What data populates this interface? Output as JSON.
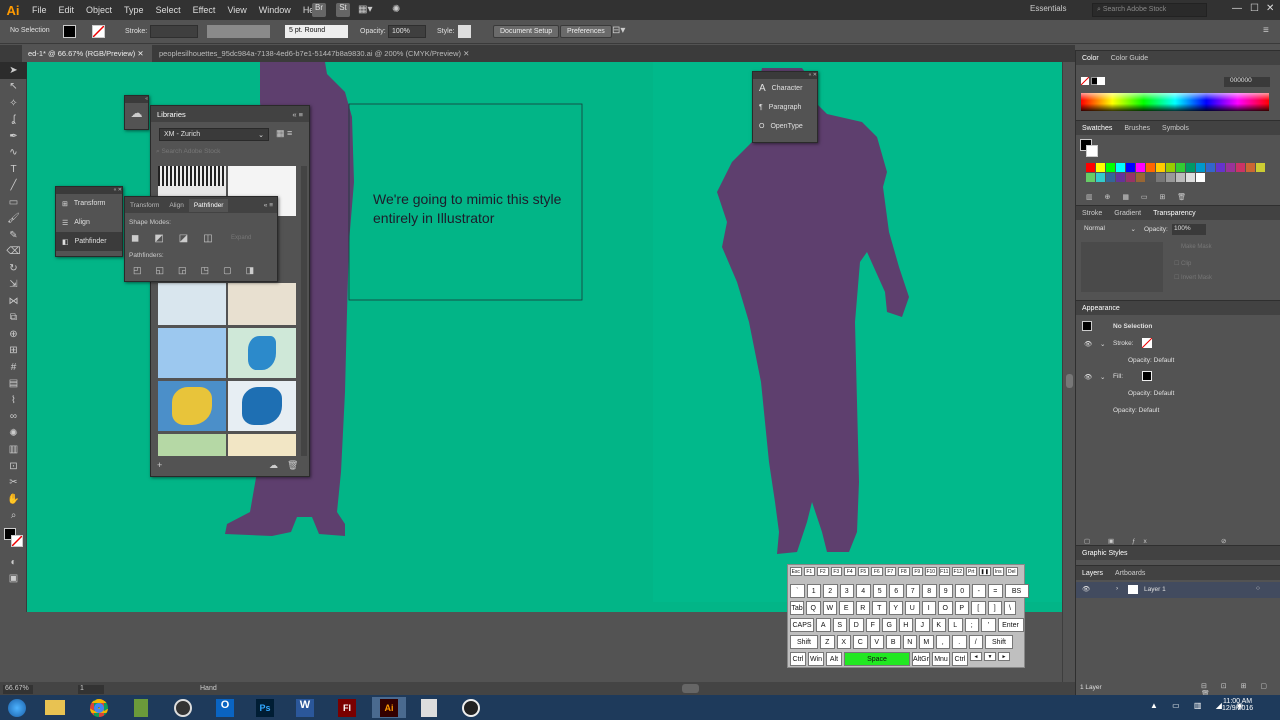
{
  "app": {
    "logo": "Ai"
  },
  "menu": [
    "File",
    "Edit",
    "Object",
    "Type",
    "Select",
    "Effect",
    "View",
    "Window",
    "Help"
  ],
  "workspace": "Essentials",
  "search_placeholder": "Search Adobe Stock",
  "control": {
    "selection": "No Selection",
    "stroke_label": "Stroke:",
    "stroke_weight": "5 pt. Round",
    "opacity_label": "Opacity:",
    "opacity": "100%",
    "style_label": "Style:",
    "doc_setup": "Document Setup",
    "preferences": "Preferences"
  },
  "tabs": [
    {
      "label": "ed-1* @ 66.67% (RGB/Preview)",
      "active": true
    },
    {
      "label": "peoplesilhouettes_95dc984a-7138-4ed6-b7e1-51447b8a9830.ai @ 200% (CMYK/Preview)",
      "active": false
    }
  ],
  "canvas_text": [
    "We're going to mimic this style",
    "entirely in Illustrator"
  ],
  "libraries": {
    "title": "Libraries",
    "library": "XM - Zurich",
    "search": "Search Adobe Stock"
  },
  "mini_panel": {
    "items": [
      "Transform",
      "Align",
      "Pathfinder"
    ]
  },
  "pathfinder": {
    "tabs": [
      "Transform",
      "Align",
      "Pathfinder"
    ],
    "shape_modes": "Shape Modes:",
    "expand": "Expand",
    "pathfinders": "Pathfinders:"
  },
  "char_panel": {
    "items": [
      "Character",
      "Paragraph",
      "OpenType"
    ]
  },
  "color_panel": {
    "tabs": [
      "Color",
      "Color Guide"
    ],
    "hex": "000000"
  },
  "swatches_panel": {
    "tabs": [
      "Swatches",
      "Brushes",
      "Symbols"
    ]
  },
  "transparency_panel": {
    "tabs": [
      "Stroke",
      "Gradient",
      "Transparency"
    ],
    "mode": "Normal",
    "opacity_label": "Opacity:",
    "opacity": "100%",
    "make_mask": "Make Mask",
    "clip": "Clip",
    "invert": "Invert Mask"
  },
  "appearance": {
    "title": "Appearance",
    "selection": "No Selection",
    "stroke": "Stroke:",
    "fill": "Fill:",
    "opacity1": "Opacity:",
    "opacity1_val": "Default",
    "opacity2": "Opacity:",
    "opacity2_val": "Default",
    "opacity3": "Opacity:",
    "opacity3_val": "Default"
  },
  "graphic_styles": {
    "title": "Graphic Styles"
  },
  "layers": {
    "tabs": [
      "Layers",
      "Artboards"
    ],
    "layer": "Layer 1",
    "count": "1 Layer"
  },
  "status": {
    "zoom": "66.67%",
    "page": "1",
    "tool": "Hand"
  },
  "keyboard": {
    "frow": [
      "Esc",
      "F1",
      "F2",
      "F3",
      "F4",
      "F5",
      "F6",
      "F7",
      "F8",
      "F9",
      "F10",
      "F11",
      "F12",
      "Prt",
      "❚❚",
      "Ins",
      "Del"
    ],
    "rows": [
      [
        "`",
        "1",
        "2",
        "3",
        "4",
        "5",
        "6",
        "7",
        "8",
        "9",
        "0",
        "-",
        "=",
        "BS"
      ],
      [
        "Tab",
        "Q",
        "W",
        "E",
        "R",
        "T",
        "Y",
        "U",
        "I",
        "O",
        "P",
        "[",
        "]",
        "\\"
      ],
      [
        "CAPS",
        "A",
        "S",
        "D",
        "F",
        "G",
        "H",
        "J",
        "K",
        "L",
        ";",
        "'",
        "Enter"
      ],
      [
        "Shift",
        "Z",
        "X",
        "C",
        "V",
        "B",
        "N",
        "M",
        ",",
        ".",
        "/",
        "Shift"
      ],
      [
        "Ctrl",
        "Win",
        "Alt",
        "Space",
        "AltGr",
        "Mnu",
        "Ctrl",
        "◄",
        "▼",
        "►"
      ]
    ]
  },
  "clock": {
    "time": "11:00 AM",
    "date": "12/9/2016"
  },
  "colors": {
    "canvas": "#02b587",
    "silhouette": "#5e3f6e",
    "active_key": "#22e822"
  }
}
